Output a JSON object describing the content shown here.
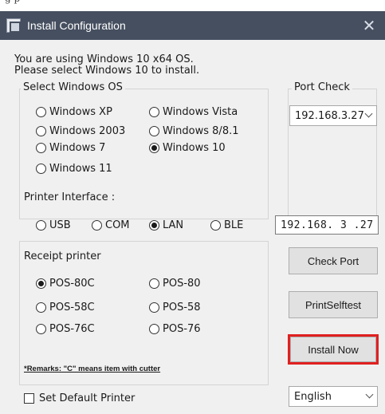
{
  "window": {
    "title": "Install Configuration",
    "close_glyph": "✕"
  },
  "top_sliver_text": "g                                  p",
  "intro": {
    "line1": "You are using Windows 10 x64 OS.",
    "line2": "Please select Windows 10 to install."
  },
  "windows_os": {
    "label": "Select Windows OS",
    "options": [
      {
        "label": "Windows XP",
        "selected": false
      },
      {
        "label": "Windows Vista",
        "selected": false
      },
      {
        "label": "Windows 2003",
        "selected": false
      },
      {
        "label": "Windows 8/8.1",
        "selected": false
      },
      {
        "label": "Windows 7",
        "selected": false
      },
      {
        "label": "Windows 10",
        "selected": true
      },
      {
        "label": "Windows 11",
        "selected": false
      }
    ]
  },
  "port_check": {
    "label": "Port Check",
    "selected_value": "192.168.3.27"
  },
  "printer_interface": {
    "label": "Printer Interface :",
    "options": [
      {
        "label": "USB",
        "selected": false
      },
      {
        "label": "COM",
        "selected": false
      },
      {
        "label": "LAN",
        "selected": true
      },
      {
        "label": "BLE",
        "selected": false
      }
    ],
    "ip_value": "192.168. 3 .27"
  },
  "receipt_printer": {
    "label": "Receipt printer",
    "options": [
      {
        "label": "POS-80C",
        "selected": true
      },
      {
        "label": "POS-80",
        "selected": false
      },
      {
        "label": "POS-58C",
        "selected": false
      },
      {
        "label": "POS-58",
        "selected": false
      },
      {
        "label": "POS-76C",
        "selected": false
      },
      {
        "label": "POS-76",
        "selected": false
      }
    ],
    "remark": "*Remarks: \"C\" means item with cutter"
  },
  "buttons": {
    "check_port": "Check Port",
    "print_selftest": "PrintSelftest",
    "install_now": "Install Now"
  },
  "default_printer": {
    "label": "Set Default Printer",
    "checked": false
  },
  "language": {
    "selected_value": "English"
  },
  "colors": {
    "titlebar": "#454f5f",
    "highlight": "#e02020",
    "dialog_bg": "#f0f0f0"
  }
}
